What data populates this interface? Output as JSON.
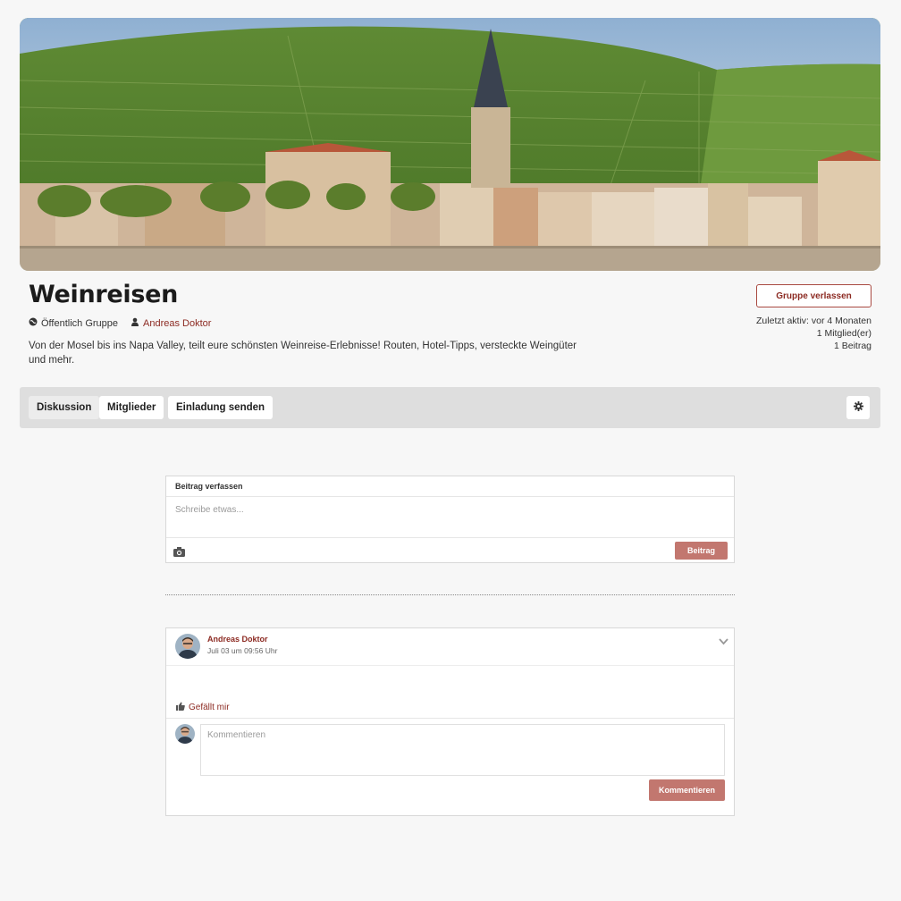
{
  "group": {
    "title": "Weinreisen",
    "visibility": "Öffentlich Gruppe",
    "owner": "Andreas Doktor",
    "description": "Von der Mosel bis ins Napa Valley, teilt eure schönsten Weinreise-Erlebnisse! Routen, Hotel-Tipps, versteckte Weingüter und mehr.",
    "leave_label": "Gruppe verlassen",
    "last_active": "Zuletzt aktiv: vor 4 Monaten",
    "members_count": "1 Mitglied(er)",
    "posts_count": "1 Beitrag"
  },
  "tabs": [
    {
      "label": "Diskussion",
      "active": true
    },
    {
      "label": "Mitglieder",
      "active": false
    },
    {
      "label": "Einladung senden",
      "active": false
    }
  ],
  "composer": {
    "title": "Beitrag verfassen",
    "placeholder": "Schreibe etwas...",
    "submit_label": "Beitrag"
  },
  "post": {
    "author": "Andreas Doktor",
    "timestamp": "Juli 03 um 09:56 Uhr",
    "like_label": "Gefällt mir",
    "comment_placeholder": "Kommentieren",
    "comment_submit_label": "Kommentieren"
  },
  "icons": {
    "visibility": "globe-icon",
    "owner": "user-icon",
    "settings": "gear-icon",
    "camera": "camera-icon",
    "like": "thumbs-up-icon",
    "menu": "chevron-down-icon"
  },
  "colors": {
    "accent": "#8c2a22",
    "button_fill": "#c2776f",
    "tabbar_bg": "#dedede"
  }
}
